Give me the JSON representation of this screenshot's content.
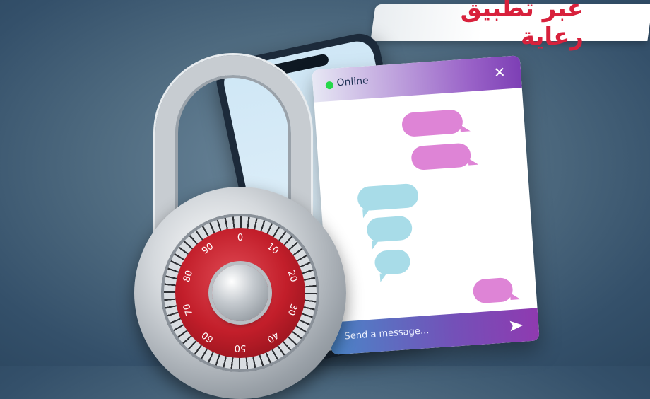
{
  "banner": {
    "text": "عبر تطبيق رعاية"
  },
  "chat": {
    "status_label": "Online",
    "close_icon": "close-icon",
    "input_placeholder": "Send a message...",
    "send_icon": "send-icon"
  },
  "lock": {
    "dial_numbers": [
      "0",
      "10",
      "20",
      "30",
      "40",
      "50",
      "60",
      "70",
      "80",
      "90"
    ]
  },
  "colors": {
    "banner_text": "#d8213c",
    "online_dot": "#25d84a",
    "bubble_outgoing": "#de84d6",
    "bubble_incoming": "#a8dce8",
    "dial_red": "#c21e2a"
  }
}
